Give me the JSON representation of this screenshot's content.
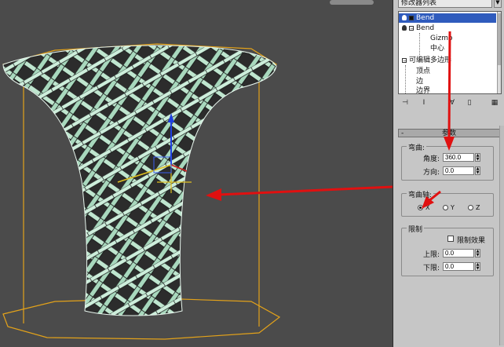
{
  "modifier_list": {
    "dropdown_label": "修改器列表"
  },
  "stack": {
    "items": [
      {
        "label": "Bend",
        "level": 0,
        "selected": true
      },
      {
        "label": "Bend",
        "level": 0,
        "selected": false
      },
      {
        "label": "Gizmo",
        "level": 1,
        "selected": false
      },
      {
        "label": "中心",
        "level": 1,
        "selected": false
      },
      {
        "label": "可编辑多边形",
        "level": 0,
        "selected": false
      },
      {
        "label": "顶点",
        "level": 1,
        "selected": false
      },
      {
        "label": "边",
        "level": 1,
        "selected": false
      },
      {
        "label": "边界",
        "level": 1,
        "selected": false
      }
    ]
  },
  "toolbar": {
    "icons": [
      "pin-stack-icon",
      "show-end-result-icon",
      "make-unique-icon",
      "remove-modifier-icon",
      "configure-modifier-sets-icon"
    ]
  },
  "rollout": {
    "title": "参数",
    "collapse_symbol": "-"
  },
  "bend_group": {
    "title": "弯曲:",
    "angle_label": "角度:",
    "angle_value": "360.0",
    "direction_label": "方向:",
    "direction_value": "0.0"
  },
  "axis_group": {
    "title": "弯曲轴:",
    "options": [
      "X",
      "Y",
      "Z"
    ],
    "selected": "X"
  },
  "limits_group": {
    "title": "限制",
    "limit_effect_label": "限制效果",
    "limit_effect_checked": false,
    "upper_label": "上限:",
    "upper_value": "0.0",
    "lower_label": "下限:",
    "lower_value": "0.0"
  },
  "colors": {
    "viewport_bg": "#4b4b4b",
    "mesh_fill": "#bfe6cf",
    "mesh_edge": "#1a1a1a",
    "bbox": "#e3a21a",
    "arrow": "#e01010",
    "selection": "#2f5bbd"
  }
}
